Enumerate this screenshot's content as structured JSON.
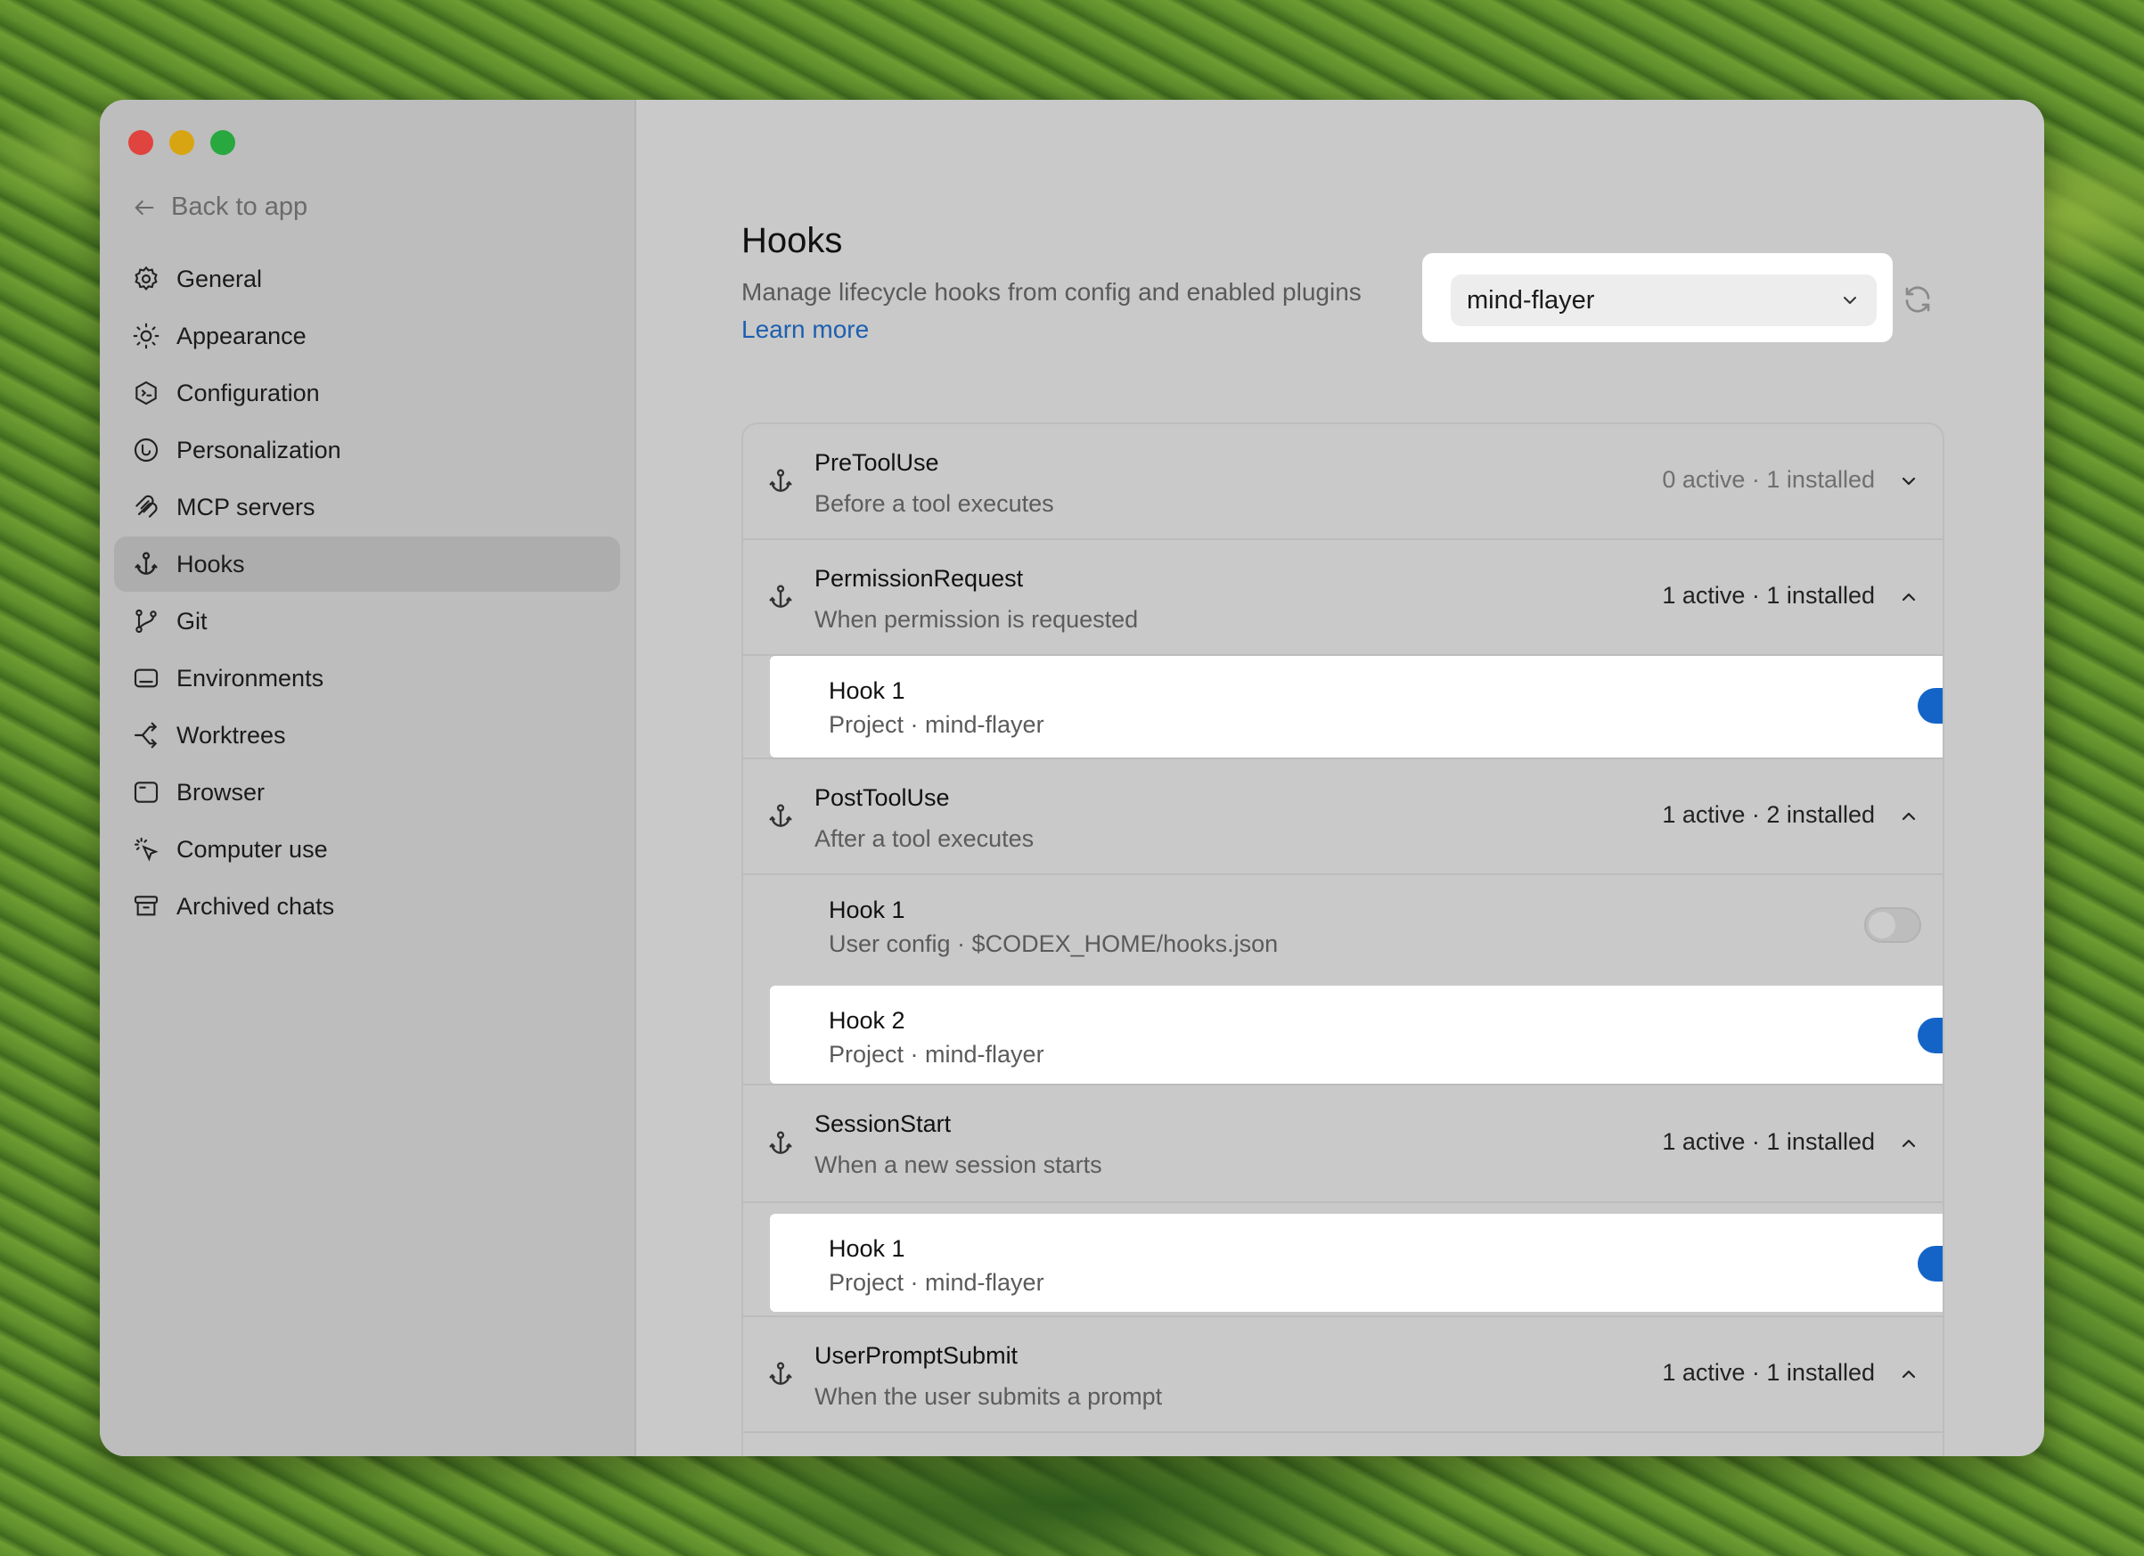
{
  "sidebar": {
    "back_label": "Back to app",
    "items": [
      {
        "label": "General",
        "icon": "gear-icon"
      },
      {
        "label": "Appearance",
        "icon": "sun-icon"
      },
      {
        "label": "Configuration",
        "icon": "config-icon"
      },
      {
        "label": "Personalization",
        "icon": "personalization-icon"
      },
      {
        "label": "MCP servers",
        "icon": "mcp-icon"
      },
      {
        "label": "Hooks",
        "icon": "anchor-icon",
        "active": true
      },
      {
        "label": "Git",
        "icon": "git-branch-icon"
      },
      {
        "label": "Environments",
        "icon": "environment-icon"
      },
      {
        "label": "Worktrees",
        "icon": "worktree-icon"
      },
      {
        "label": "Browser",
        "icon": "browser-icon"
      },
      {
        "label": "Computer use",
        "icon": "cursor-click-icon"
      },
      {
        "label": "Archived chats",
        "icon": "archive-icon"
      }
    ]
  },
  "header": {
    "title": "Hooks",
    "subtitle": "Manage lifecycle hooks from config and enabled plugins",
    "learn_more": "Learn more",
    "project_select": "mind-flayer"
  },
  "groups": [
    {
      "name": "PreToolUse",
      "desc": "Before a tool executes",
      "count": "0 active · 1 installed",
      "expanded": false,
      "hooks": []
    },
    {
      "name": "PermissionRequest",
      "desc": "When permission is requested",
      "count": "1 active · 1 installed",
      "expanded": true,
      "hooks": [
        {
          "name": "Hook 1",
          "source": "Project · mind-flayer",
          "enabled": true
        }
      ]
    },
    {
      "name": "PostToolUse",
      "desc": "After a tool executes",
      "count": "1 active · 2 installed",
      "expanded": true,
      "hooks": [
        {
          "name": "Hook 1",
          "source": "User config · $CODEX_HOME/hooks.json",
          "enabled": false
        },
        {
          "name": "Hook 2",
          "source": "Project · mind-flayer",
          "enabled": true
        }
      ]
    },
    {
      "name": "SessionStart",
      "desc": "When a new session starts",
      "count": "1 active · 1 installed",
      "expanded": true,
      "hooks": [
        {
          "name": "Hook 1",
          "source": "Project · mind-flayer",
          "enabled": true
        }
      ]
    },
    {
      "name": "UserPromptSubmit",
      "desc": "When the user submits a prompt",
      "count": "1 active · 1 installed",
      "expanded": true,
      "hooks": []
    }
  ],
  "colors": {
    "accent": "#1464c8",
    "link": "#1d5fb0"
  }
}
